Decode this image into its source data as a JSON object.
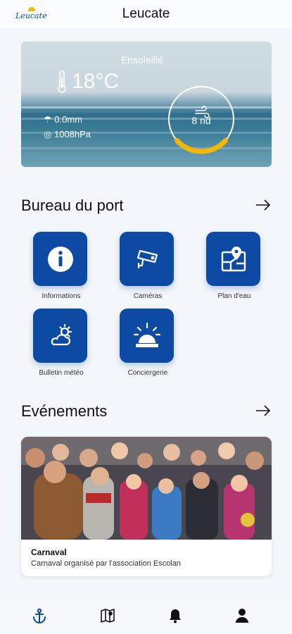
{
  "header": {
    "logo_text": "Leucate",
    "title": "Leucate"
  },
  "weather": {
    "condition": "Ensoleillé",
    "temperature": "18°C",
    "rain": "0.0mm",
    "pressure": "1008hPa",
    "wind": "8 nd",
    "wind_gauge_fraction": 0.27
  },
  "port": {
    "title": "Bureau du port",
    "tiles": [
      {
        "label": "Informations",
        "icon": "info-icon"
      },
      {
        "label": "Caméras",
        "icon": "camera-icon"
      },
      {
        "label": "Plan d'eau",
        "icon": "map-pin-icon"
      },
      {
        "label": "Bulletin météo",
        "icon": "cloud-sun-icon"
      },
      {
        "label": "Conciergerie",
        "icon": "bell-alarm-icon"
      }
    ]
  },
  "events": {
    "title": "Evénements",
    "items": [
      {
        "title": "Carnaval",
        "description": "Carnaval organisé par l'association Escolan"
      }
    ]
  },
  "nav": {
    "items": [
      {
        "icon": "anchor-icon",
        "active": true
      },
      {
        "icon": "map-icon",
        "active": false
      },
      {
        "icon": "bell-icon",
        "active": false
      },
      {
        "icon": "user-icon",
        "active": false
      }
    ]
  },
  "colors": {
    "primary": "#0c4aa3",
    "gauge_accent": "#f2b900",
    "background": "#f3f6fa"
  }
}
